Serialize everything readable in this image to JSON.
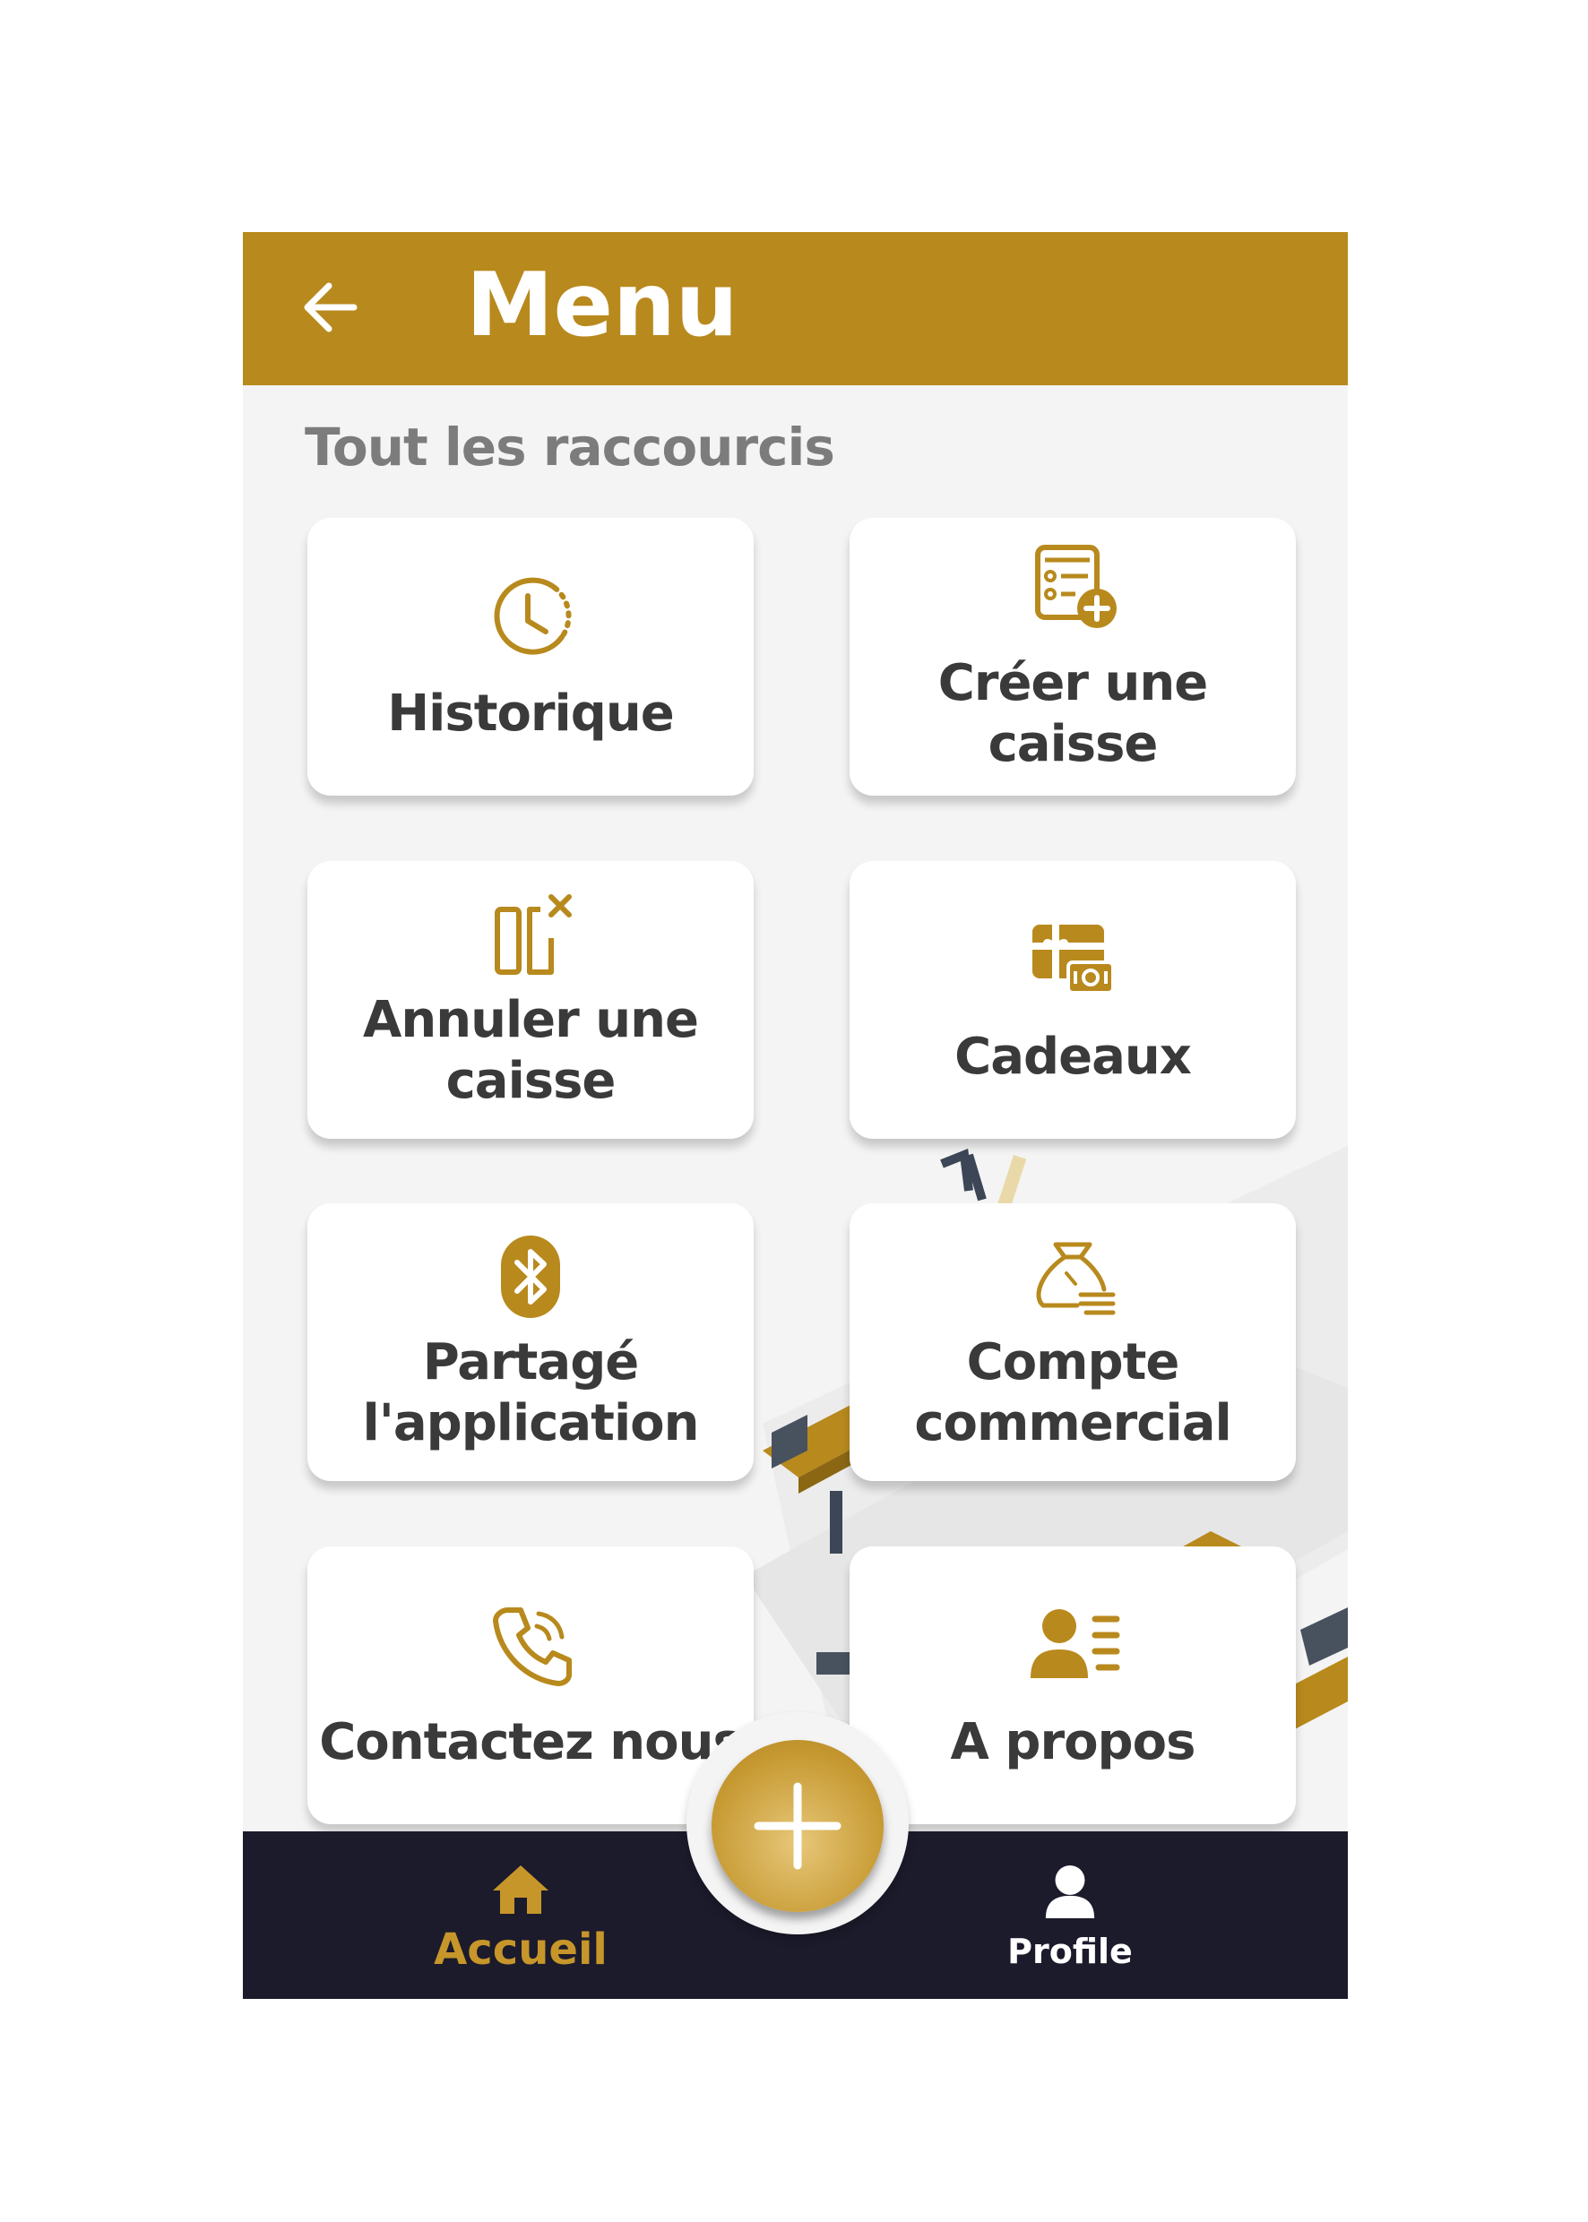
{
  "header": {
    "title": "Menu",
    "back_icon": "arrow-left-icon"
  },
  "section": {
    "title": "Tout les raccourcis"
  },
  "shortcuts": [
    {
      "label": "Historique",
      "icon": "clock-icon"
    },
    {
      "label": "Créer une caisse",
      "icon": "create-register-icon"
    },
    {
      "label": "Annuler une\ncaisse",
      "icon": "cancel-register-icon"
    },
    {
      "label": "Cadeaux",
      "icon": "gift-card-icon"
    },
    {
      "label": "Partagé\nl'application",
      "icon": "bluetooth-icon"
    },
    {
      "label": "Compte\ncommercial",
      "icon": "money-bag-icon"
    },
    {
      "label": "Contactez nous",
      "icon": "phone-icon"
    },
    {
      "label": "A propos",
      "icon": "user-info-icon"
    }
  ],
  "bottom_nav": {
    "home_label": "Accueil",
    "profile_label": "Profile",
    "fab_icon": "plus-icon"
  },
  "colors": {
    "accent": "#b8891d",
    "nav_bg": "#1c1b2c",
    "card_text": "#3a3a3a",
    "section_text": "#7c7c7c"
  }
}
